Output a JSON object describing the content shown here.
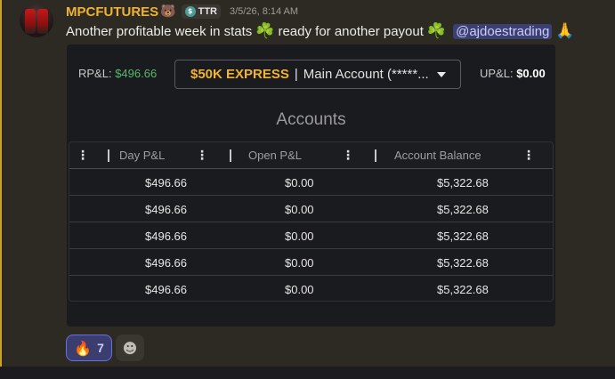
{
  "message": {
    "username": "MPCFUTURES",
    "username_emoji": "🐻",
    "tag_label": "TTR",
    "tag_icon": "$",
    "timestamp": "3/5/26, 8:14 AM",
    "text_part1": "Another profitable week in stats",
    "clover_emoji": "☘️",
    "text_part2": "ready for another payout",
    "mention": "@ajdoestrading",
    "pray_emoji": "🙏"
  },
  "embed": {
    "rpl_label": "RP&L:",
    "rpl_value": "$496.66",
    "account_plan": "$50K EXPRESS",
    "account_separator": "|",
    "account_name": "Main Account (*****...",
    "upl_label": "UP&L:",
    "upl_value": "$0.00",
    "accounts_title": "Accounts",
    "columns": [
      "Day P&L",
      "Open P&L",
      "Account Balance"
    ],
    "rows": [
      [
        "$496.66",
        "$0.00",
        "$5,322.68"
      ],
      [
        "$496.66",
        "$0.00",
        "$5,322.68"
      ],
      [
        "$496.66",
        "$0.00",
        "$5,322.68"
      ],
      [
        "$496.66",
        "$0.00",
        "$5,322.68"
      ],
      [
        "$496.66",
        "$0.00",
        "$5,322.68"
      ]
    ]
  },
  "reactions": {
    "fire_emoji": "🔥",
    "fire_count": "7",
    "add_reaction_icon": "smiley-icon"
  },
  "colors": {
    "username": "#f0b232",
    "positive": "#56b66a",
    "mention_bg": "#3c3f72",
    "reaction_border": "#6470e6"
  }
}
